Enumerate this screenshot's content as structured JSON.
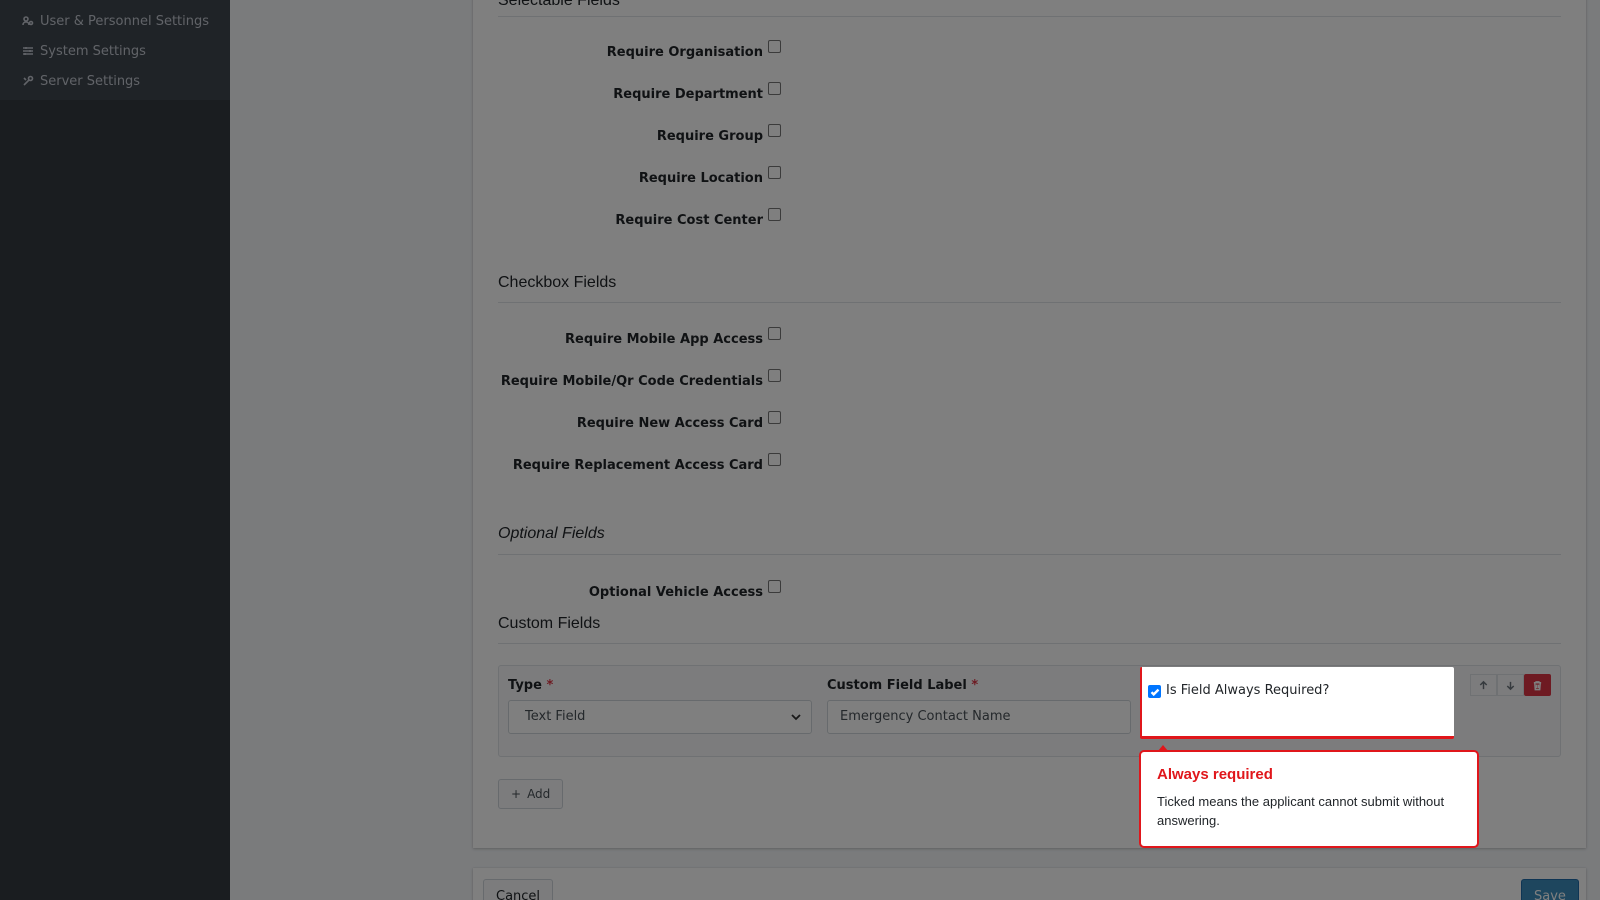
{
  "sidebar": {
    "items": [
      {
        "label": "User & Personnel Settings",
        "icon": "users-cog-icon"
      },
      {
        "label": "System Settings",
        "icon": "sliders-icon"
      },
      {
        "label": "Server Settings",
        "icon": "tools-icon"
      }
    ]
  },
  "sections": {
    "selectable": {
      "title": "Selectable Fields",
      "fields": [
        {
          "label": "Require Organisation",
          "checked": false
        },
        {
          "label": "Require Department",
          "checked": false
        },
        {
          "label": "Require Group",
          "checked": false
        },
        {
          "label": "Require Location",
          "checked": false
        },
        {
          "label": "Require Cost Center",
          "checked": false
        }
      ]
    },
    "checkbox": {
      "title": "Checkbox Fields",
      "fields": [
        {
          "label": "Require Mobile App Access",
          "checked": false
        },
        {
          "label": "Require Mobile/Qr Code Credentials",
          "checked": false
        },
        {
          "label": "Require New Access Card",
          "checked": false
        },
        {
          "label": "Require Replacement Access Card",
          "checked": false
        }
      ]
    },
    "optional": {
      "title": "Optional Fields",
      "fields": [
        {
          "label": "Optional Vehicle Access",
          "checked": false
        }
      ]
    },
    "custom": {
      "title": "Custom Fields",
      "type_label": "Type",
      "type_required_mark": "*",
      "type_value": "Text Field",
      "field_label_label": "Custom Field Label",
      "field_label_required_mark": "*",
      "field_label_value": "Emergency Contact Name",
      "always_required_label": "Is Field Always Required?",
      "always_required_checked": true,
      "add_label": "Add"
    }
  },
  "footer": {
    "cancel_label": "Cancel",
    "save_label": "Save"
  },
  "tooltip": {
    "title": "Always required",
    "body": "Ticked means the applicant cannot submit without answering."
  },
  "colors": {
    "accent_red": "#e0161b",
    "checkbox_blue": "#0075ff",
    "save_blue": "#3c8dbc",
    "sidebar_bg": "#343a40"
  }
}
